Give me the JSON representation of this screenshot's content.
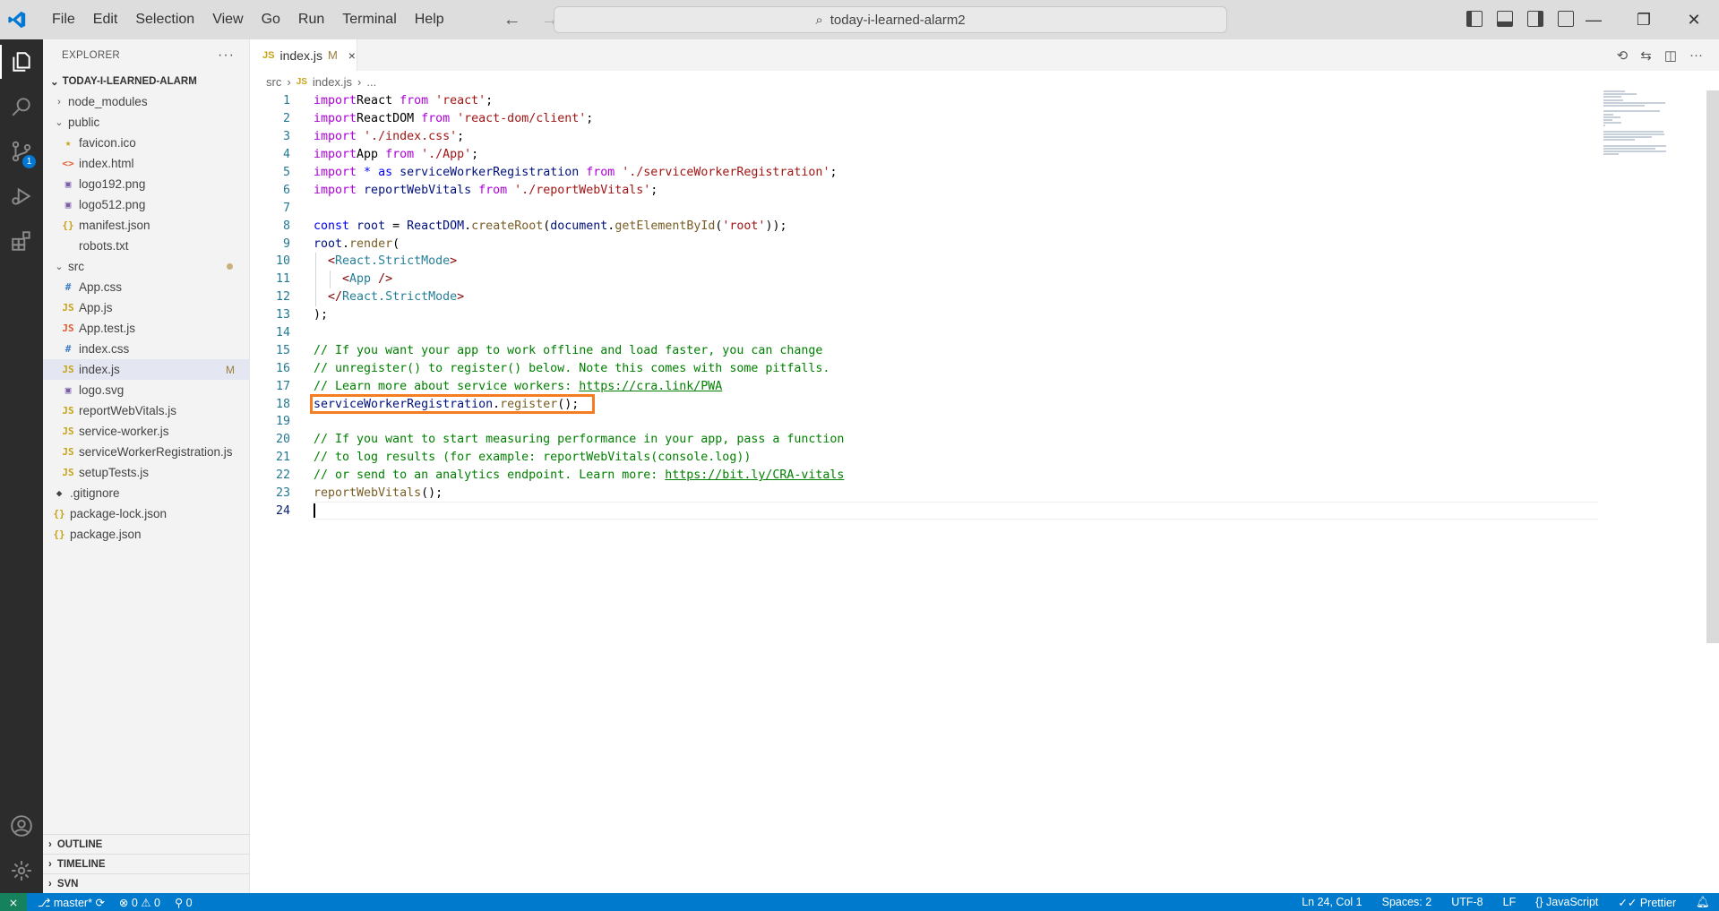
{
  "menu": [
    "File",
    "Edit",
    "Selection",
    "View",
    "Go",
    "Run",
    "Terminal",
    "Help"
  ],
  "search": {
    "text": "today-i-learned-alarm2"
  },
  "sidebar": {
    "title": "EXPLORER",
    "project": "TODAY-I-LEARNED-ALARM",
    "items": [
      {
        "label": "node_modules",
        "indent": 1,
        "type": "folder",
        "icon": "›"
      },
      {
        "label": "public",
        "indent": 1,
        "type": "folder-open",
        "icon": "⌄"
      },
      {
        "label": "favicon.ico",
        "indent": 2,
        "type": "file",
        "icon": "★",
        "color": "#c7a31a"
      },
      {
        "label": "index.html",
        "indent": 2,
        "type": "file",
        "icon": "<>",
        "color": "#e05b31"
      },
      {
        "label": "logo192.png",
        "indent": 2,
        "type": "file",
        "icon": "▣",
        "color": "#7b5ea7"
      },
      {
        "label": "logo512.png",
        "indent": 2,
        "type": "file",
        "icon": "▣",
        "color": "#7b5ea7"
      },
      {
        "label": "manifest.json",
        "indent": 2,
        "type": "file",
        "icon": "{}",
        "color": "#c7a31a"
      },
      {
        "label": "robots.txt",
        "indent": 2,
        "type": "file",
        "icon": "",
        "color": "#777"
      },
      {
        "label": "src",
        "indent": 1,
        "type": "folder-open",
        "icon": "⌄",
        "dot": true
      },
      {
        "label": "App.css",
        "indent": 2,
        "type": "file",
        "icon": "#",
        "color": "#3e7fc7"
      },
      {
        "label": "App.js",
        "indent": 2,
        "type": "file",
        "icon": "JS",
        "color": "#c7a31a"
      },
      {
        "label": "App.test.js",
        "indent": 2,
        "type": "file",
        "icon": "JS",
        "color": "#e05b31"
      },
      {
        "label": "index.css",
        "indent": 2,
        "type": "file",
        "icon": "#",
        "color": "#3e7fc7"
      },
      {
        "label": "index.js",
        "indent": 2,
        "type": "file",
        "icon": "JS",
        "color": "#c7a31a",
        "selected": true,
        "mark": "M"
      },
      {
        "label": "logo.svg",
        "indent": 2,
        "type": "file",
        "icon": "▣",
        "color": "#7b5ea7"
      },
      {
        "label": "reportWebVitals.js",
        "indent": 2,
        "type": "file",
        "icon": "JS",
        "color": "#c7a31a"
      },
      {
        "label": "service-worker.js",
        "indent": 2,
        "type": "file",
        "icon": "JS",
        "color": "#c7a31a"
      },
      {
        "label": "serviceWorkerRegistration.js",
        "indent": 2,
        "type": "file",
        "icon": "JS",
        "color": "#c7a31a"
      },
      {
        "label": "setupTests.js",
        "indent": 2,
        "type": "file",
        "icon": "JS",
        "color": "#c7a31a"
      },
      {
        "label": ".gitignore",
        "indent": 1,
        "type": "file",
        "icon": "◆",
        "color": "#444"
      },
      {
        "label": "package-lock.json",
        "indent": 1,
        "type": "file",
        "icon": "{}",
        "color": "#c7a31a"
      },
      {
        "label": "package.json",
        "indent": 1,
        "type": "file",
        "icon": "{}",
        "color": "#c7a31a"
      }
    ],
    "sections": [
      "OUTLINE",
      "TIMELINE",
      "SVN"
    ]
  },
  "activity": {
    "scm_badge": "1"
  },
  "tab": {
    "label": "index.js",
    "mark": "M",
    "close": "×"
  },
  "breadcrumb": [
    "src",
    "index.js",
    "..."
  ],
  "code": {
    "lines": [
      [
        [
          "kw2",
          "import"
        ],
        [
          "",
          "React "
        ],
        [
          "kw2",
          "from"
        ],
        [
          "str",
          " 'react'"
        ],
        [
          "",
          ";"
        ]
      ],
      [
        [
          "kw2",
          "import"
        ],
        [
          "",
          "ReactDOM "
        ],
        [
          "kw2",
          "from"
        ],
        [
          "str",
          " 'react-dom/client'"
        ],
        [
          "",
          ";"
        ]
      ],
      [
        [
          "kw2",
          "import"
        ],
        [
          "str",
          " './index.css'"
        ],
        [
          "",
          ";"
        ]
      ],
      [
        [
          "kw2",
          "import"
        ],
        [
          "",
          "App "
        ],
        [
          "kw2",
          "from"
        ],
        [
          "str",
          " './App'"
        ],
        [
          "",
          ";"
        ]
      ],
      [
        [
          "kw2",
          "import"
        ],
        [
          "kw",
          " * "
        ],
        [
          "kw",
          "as"
        ],
        [
          "var",
          " serviceWorkerRegistration "
        ],
        [
          "kw2",
          "from"
        ],
        [
          "str",
          " './serviceWorkerRegistration'"
        ],
        [
          "",
          ";"
        ]
      ],
      [
        [
          "kw2",
          "import"
        ],
        [
          "var",
          " reportWebVitals "
        ],
        [
          "kw2",
          "from"
        ],
        [
          "str",
          " './reportWebVitals'"
        ],
        [
          "",
          ";"
        ]
      ],
      [],
      [
        [
          "kw",
          "const "
        ],
        [
          "var",
          "root"
        ],
        [
          "",
          " = "
        ],
        [
          "var",
          "ReactDOM"
        ],
        [
          "",
          "."
        ],
        [
          "fn",
          "createRoot"
        ],
        [
          "",
          "("
        ],
        [
          "var",
          "document"
        ],
        [
          "",
          "."
        ],
        [
          "fn",
          "getElementById"
        ],
        [
          "",
          "("
        ],
        [
          "str",
          "'root'"
        ],
        [
          "",
          "));"
        ]
      ],
      [
        [
          "var",
          "root"
        ],
        [
          "",
          "."
        ],
        [
          "fn",
          "render"
        ],
        [
          "",
          "("
        ]
      ],
      [
        [
          "",
          ""
        ],
        [
          "tag",
          "  <"
        ],
        [
          "cls",
          "React.StrictMode"
        ],
        [
          "tag",
          ">"
        ]
      ],
      [
        [
          "tag",
          "    <"
        ],
        [
          "cls",
          "App"
        ],
        [
          "tag",
          " />"
        ]
      ],
      [
        [
          "tag",
          "  </"
        ],
        [
          "cls",
          "React.StrictMode"
        ],
        [
          "tag",
          ">"
        ]
      ],
      [
        [
          "",
          ");"
        ]
      ],
      [],
      [
        [
          "com",
          "// If you want your app to work offline and load faster, you can change"
        ]
      ],
      [
        [
          "com",
          "// unregister() to register() below. Note this comes with some pitfalls."
        ]
      ],
      [
        [
          "com",
          "// Learn more about service workers: "
        ],
        [
          "com lnk",
          "https://cra.link/PWA"
        ]
      ],
      [
        [
          "var",
          "serviceWorkerRegistration"
        ],
        [
          "",
          "."
        ],
        [
          "fn",
          "register"
        ],
        [
          "",
          "();"
        ]
      ],
      [],
      [
        [
          "com",
          "// If you want to start measuring performance in your app, pass a function"
        ]
      ],
      [
        [
          "com",
          "// to log results (for example: reportWebVitals(console.log))"
        ]
      ],
      [
        [
          "com",
          "// or send to an analytics endpoint. Learn more: "
        ],
        [
          "com lnk",
          "https://bit.ly/CRA-vitals"
        ]
      ],
      [
        [
          "fn",
          "reportWebVitals"
        ],
        [
          "",
          "();"
        ]
      ],
      []
    ],
    "highlight_line": 18,
    "cursor_line": 24
  },
  "status": {
    "branch": "master*",
    "errors": "0",
    "warnings": "0",
    "ports": "0",
    "position": "Ln 24, Col 1",
    "spaces": "Spaces: 2",
    "encoding": "UTF-8",
    "eol": "LF",
    "language": "JavaScript",
    "formatter": "Prettier"
  }
}
